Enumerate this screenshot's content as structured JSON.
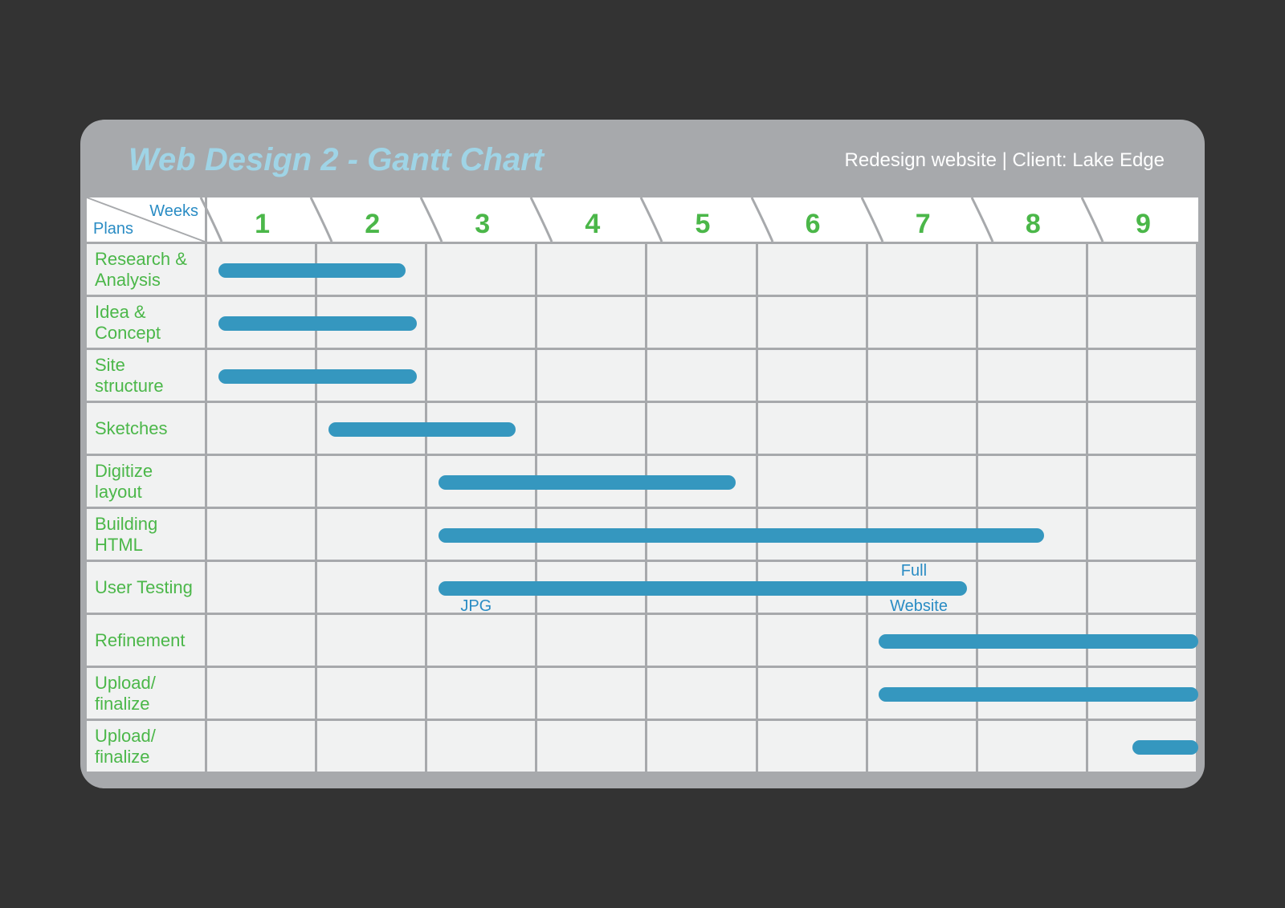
{
  "header": {
    "title": "Web Design 2 - Gantt Chart",
    "subtitle": "Redesign website | Client: Lake Edge"
  },
  "axes": {
    "weeks_label": "Weeks",
    "plans_label": "Plans",
    "weeks": [
      "1",
      "2",
      "3",
      "4",
      "5",
      "6",
      "7",
      "8",
      "9"
    ]
  },
  "plans": [
    "Research & Analysis",
    "Idea & Concept",
    "Site structure",
    "Sketches",
    "Digitize layout",
    "Building HTML",
    "User Testing",
    "Refinement",
    "Upload/ finalize",
    "Upload/ finalize"
  ],
  "annotations": {
    "jpg": "JPG",
    "full": "Full",
    "website": "Website"
  },
  "chart_data": {
    "type": "bar",
    "orientation": "gantt",
    "x_unit": "week",
    "xlim": [
      0.5,
      9.5
    ],
    "tasks": [
      {
        "name": "Research & Analysis",
        "start": 0.6,
        "end": 2.3
      },
      {
        "name": "Idea & Concept",
        "start": 0.6,
        "end": 2.4
      },
      {
        "name": "Site structure",
        "start": 0.6,
        "end": 2.4
      },
      {
        "name": "Sketches",
        "start": 1.6,
        "end": 3.3
      },
      {
        "name": "Digitize layout",
        "start": 2.6,
        "end": 5.3
      },
      {
        "name": "Building HTML",
        "start": 2.6,
        "end": 8.1
      },
      {
        "name": "User Testing",
        "start": 2.6,
        "end": 7.4,
        "annotations": [
          {
            "text": "JPG",
            "at": 2.8,
            "pos": "below"
          },
          {
            "text": "Full",
            "at": 6.8,
            "pos": "above"
          },
          {
            "text": "Website",
            "at": 6.7,
            "pos": "below"
          }
        ]
      },
      {
        "name": "Refinement",
        "start": 6.6,
        "end": 9.5
      },
      {
        "name": "Upload/ finalize",
        "start": 6.6,
        "end": 9.5
      },
      {
        "name": "Upload/ finalize",
        "start": 8.9,
        "end": 9.5
      }
    ]
  }
}
